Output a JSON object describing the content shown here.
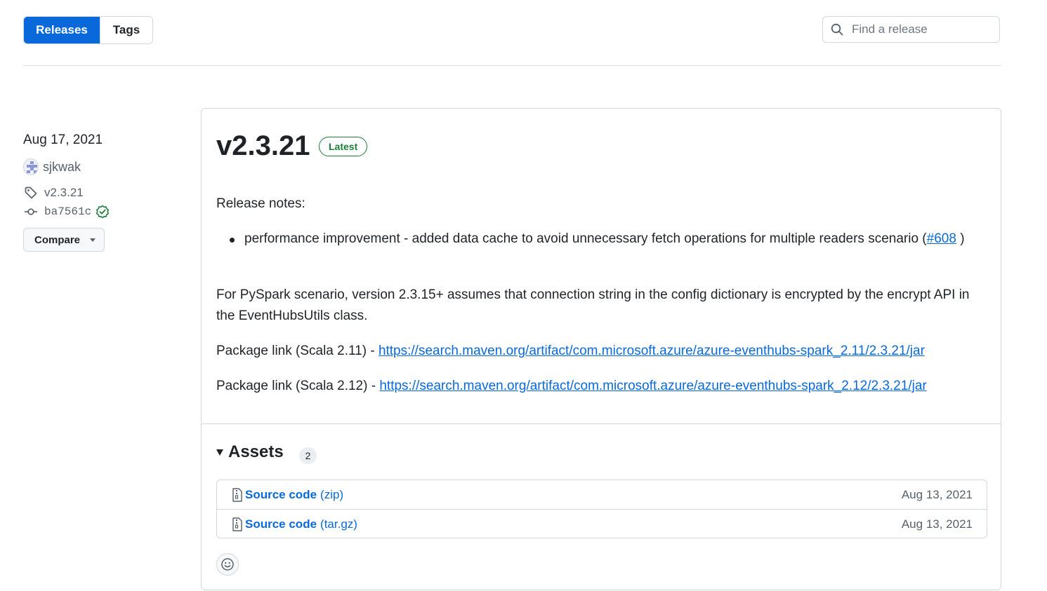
{
  "tabs": [
    {
      "label": "Releases",
      "active": true
    },
    {
      "label": "Tags",
      "active": false
    }
  ],
  "search": {
    "placeholder": "Find a release",
    "value": ""
  },
  "release": {
    "date": "Aug 17, 2021",
    "author": "sjkwak",
    "tag": "v2.3.21",
    "commit": "ba7561c",
    "compare_label": "Compare",
    "title": "v2.3.21",
    "badge": "Latest",
    "notes_heading": "Release notes:",
    "bullet_text": "performance improvement - added data cache to avoid unnecessary fetch operations for multiple readers scenario (",
    "bullet_link": "#608",
    "bullet_tail": " )",
    "paragraph": "For PySpark scenario, version 2.3.15+ assumes that connection string in the config dictionary is encrypted by the encrypt API in the EventHubsUtils class.",
    "pkg_211_label": "Package link (Scala 2.11) - ",
    "pkg_211_url": "https://search.maven.org/artifact/com.microsoft.azure/azure-eventhubs-spark_2.11/2.3.21/jar",
    "pkg_212_label": "Package link (Scala 2.12) - ",
    "pkg_212_url": "https://search.maven.org/artifact/com.microsoft.azure/azure-eventhubs-spark_2.12/2.3.21/jar"
  },
  "assets": {
    "heading": "Assets",
    "count": "2",
    "items": [
      {
        "name": "Source code",
        "ext": "(zip)",
        "date": "Aug 13, 2021"
      },
      {
        "name": "Source code",
        "ext": "(tar.gz)",
        "date": "Aug 13, 2021"
      }
    ]
  },
  "colors": {
    "accent": "#0969da",
    "success": "#1a7f37",
    "border": "#d0d7de"
  }
}
